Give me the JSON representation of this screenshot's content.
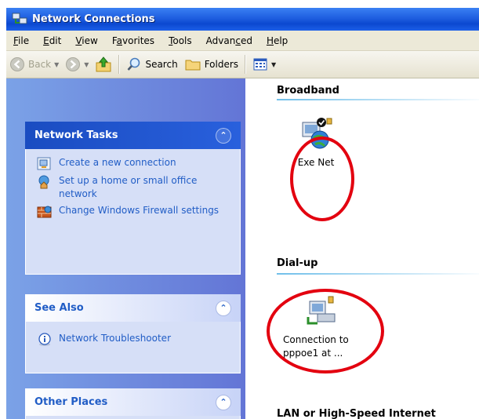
{
  "window": {
    "title": "Network Connections"
  },
  "menu": {
    "items": [
      {
        "pre": "",
        "key": "F",
        "post": "ile"
      },
      {
        "pre": "",
        "key": "E",
        "post": "dit"
      },
      {
        "pre": "",
        "key": "V",
        "post": "iew"
      },
      {
        "pre": "F",
        "key": "a",
        "post": "vorites"
      },
      {
        "pre": "",
        "key": "T",
        "post": "ools"
      },
      {
        "pre": "Advan",
        "key": "c",
        "post": "ed"
      },
      {
        "pre": "",
        "key": "H",
        "post": "elp"
      }
    ]
  },
  "toolbar": {
    "back": "Back",
    "search": "Search",
    "folders": "Folders"
  },
  "tasks_panel": {
    "title": "Network Tasks",
    "items": [
      {
        "label": "Create a new connection",
        "icon": "new-connection-icon"
      },
      {
        "label": "Set up a home or small office network",
        "icon": "home-network-icon"
      },
      {
        "label": "Change Windows Firewall settings",
        "icon": "firewall-icon"
      }
    ]
  },
  "see_also": {
    "title": "See Also",
    "items": [
      {
        "label": "Network Troubleshooter",
        "icon": "info-icon"
      }
    ]
  },
  "other_places": {
    "title": "Other Places"
  },
  "groups": {
    "broadband": {
      "title": "Broadband",
      "item": "Exe Net"
    },
    "dialup": {
      "title": "Dial-up",
      "item_line1": "Connection to",
      "item_line2": "pppoe1 at ..."
    },
    "lan": {
      "title": "LAN or High-Speed Internet"
    }
  },
  "colors": {
    "titlebar": "#0b48d0",
    "link": "#215dc6",
    "annotation": "#e3000f"
  }
}
